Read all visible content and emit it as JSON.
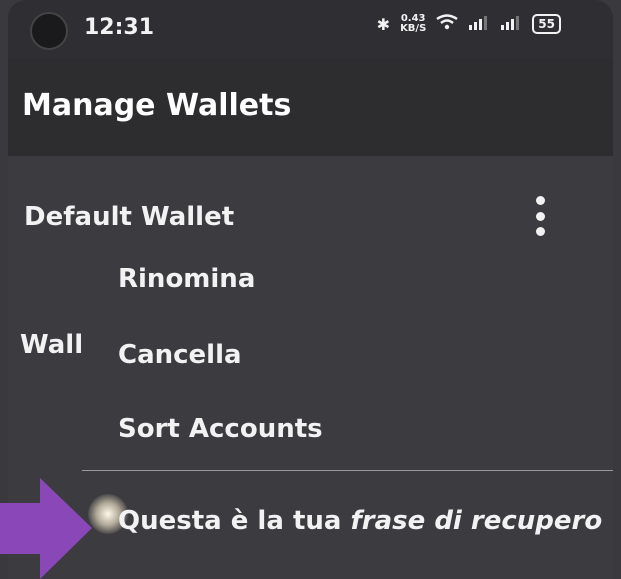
{
  "status": {
    "time": "12:31",
    "speed_value": "0.43",
    "speed_unit": "KB/S",
    "battery": "55"
  },
  "appbar": {
    "title": "Manage Wallets"
  },
  "wallet": {
    "name": "Default Wallet",
    "secondary_label": "Wall"
  },
  "menu": {
    "items": [
      {
        "label": "Rinomina"
      },
      {
        "label": "Cancella"
      },
      {
        "label": "Sort Accounts"
      }
    ]
  },
  "recovery": {
    "prefix": "Questa è la tua ",
    "emphasis": "frase di recupero"
  },
  "icons": {
    "bluetooth": "bluetooth-icon",
    "wifi": "wifi-icon",
    "signal": "signal-icon",
    "more": "more-vertical-icon",
    "arrow": "arrow-right-icon"
  },
  "colors": {
    "arrow": "#8a47b8",
    "appbar": "#2d2d30",
    "background": "#3c3c40"
  }
}
